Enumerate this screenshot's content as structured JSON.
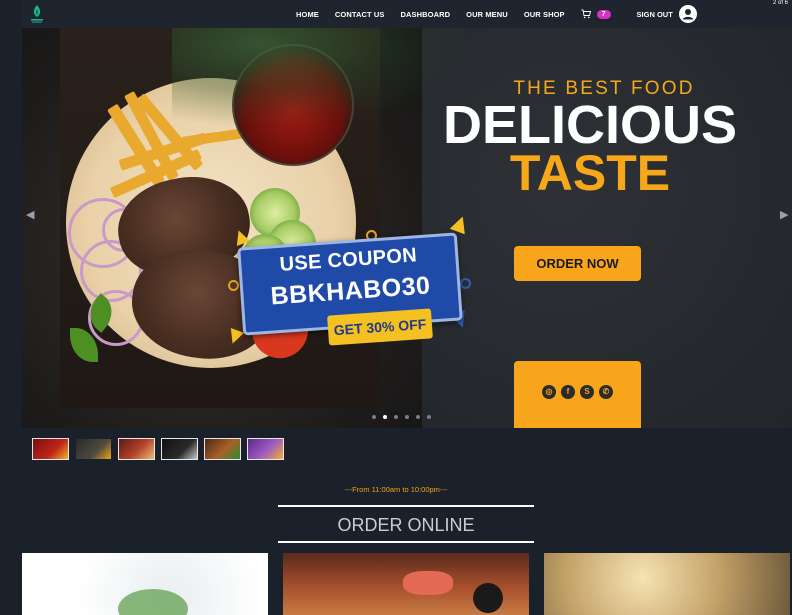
{
  "nav": {
    "links": [
      "HOME",
      "CONTACT US",
      "DASHBOARD",
      "OUR MENU",
      "OUR SHOP"
    ],
    "cart_count": "7",
    "signout_label": "SIGN OUT",
    "slide_counter": "2 of 6"
  },
  "hero": {
    "subtitle": "THE BEST FOOD",
    "title_line1": "DELICIOUS",
    "title_line2": "TASTE",
    "coupon_title": "USE COUPON",
    "coupon_code": "BBKHABO30",
    "coupon_offer": "GET 30% OFF",
    "order_button": "ORDER NOW",
    "social_icons": [
      "instagram-icon",
      "facebook-icon",
      "skype-icon",
      "whatsapp-icon"
    ],
    "slide_count": 6,
    "active_slide": 2
  },
  "thumbnails": [
    "slide-1",
    "slide-2",
    "slide-3",
    "slide-4",
    "slide-5",
    "slide-6"
  ],
  "hours": "---From 11:00am to 10:00pm---",
  "section_title": "ORDER ONLINE",
  "colors": {
    "accent": "#f8a51c",
    "background": "#1b212b",
    "coupon_blue": "#1f4aa8",
    "badge": "#d633c4"
  }
}
